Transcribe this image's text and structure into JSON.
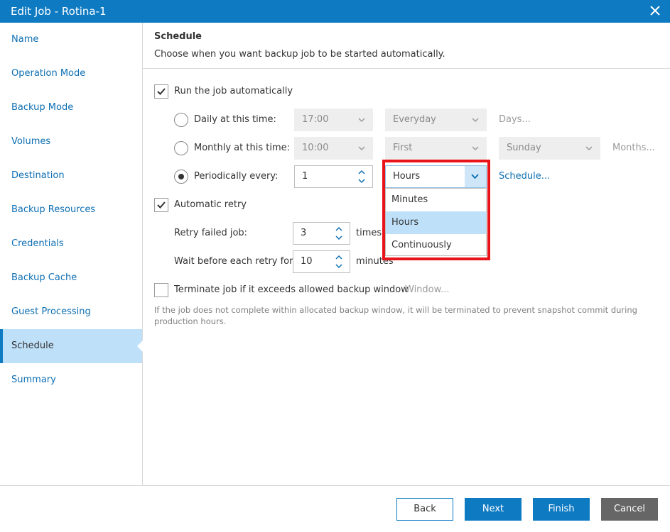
{
  "window": {
    "title": "Edit Job - Rotina-1"
  },
  "sidebar": {
    "items": [
      {
        "label": "Name"
      },
      {
        "label": "Operation Mode"
      },
      {
        "label": "Backup Mode"
      },
      {
        "label": "Volumes"
      },
      {
        "label": "Destination"
      },
      {
        "label": "Backup Resources"
      },
      {
        "label": "Credentials"
      },
      {
        "label": "Backup Cache"
      },
      {
        "label": "Guest Processing"
      },
      {
        "label": "Schedule",
        "active": true
      },
      {
        "label": "Summary"
      }
    ]
  },
  "header": {
    "title": "Schedule",
    "description": "Choose when you want backup job to be started automatically."
  },
  "schedule": {
    "run_automatically": {
      "label": "Run the job automatically",
      "checked": true
    },
    "daily": {
      "label": "Daily at this time:",
      "time": "17:00",
      "days_value": "Everyday",
      "days_link": "Days..."
    },
    "monthly": {
      "label": "Monthly at this time:",
      "time": "10:00",
      "week_value": "First",
      "day_value": "Sunday",
      "months_link": "Months..."
    },
    "periodically": {
      "label": "Periodically every:",
      "value": "1",
      "unit": "Hours",
      "schedule_link": "Schedule...",
      "selected": true
    },
    "unit_options": [
      "Minutes",
      "Hours",
      "Continuously"
    ],
    "automatic_retry": {
      "label": "Automatic retry",
      "checked": true
    },
    "retry_failed": {
      "label": "Retry failed job:",
      "value": "3",
      "unit": "times"
    },
    "wait_before": {
      "label": "Wait before each retry for:",
      "value": "10",
      "unit": "minutes"
    },
    "terminate": {
      "label": "Terminate job if it exceeds allowed backup window",
      "checked": false,
      "window_link": "Window..."
    },
    "note": "If the job does not complete within allocated backup window, it will be terminated to prevent snapshot commit during production hours."
  },
  "footer": {
    "back": "Back",
    "next": "Next",
    "finish": "Finish",
    "cancel": "Cancel"
  },
  "colors": {
    "accent": "#0e7ac2",
    "selected_bg": "#bfe0f9",
    "highlight": "#e8141a"
  }
}
